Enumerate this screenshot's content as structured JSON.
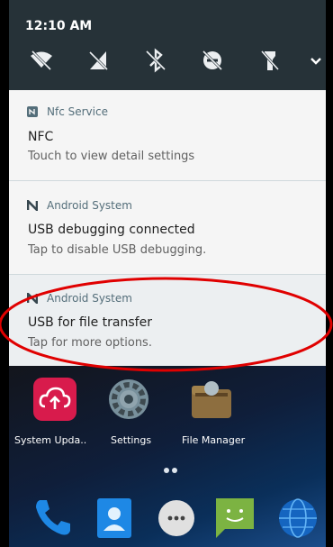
{
  "status_bar": {
    "time": "12:10 AM"
  },
  "quick_settings": {
    "icons": [
      "wifi-off-icon",
      "mobile-data-off-icon",
      "bluetooth-off-icon",
      "dnd-icon",
      "flashlight-off-icon"
    ],
    "expand_icon": "chevron-down-icon"
  },
  "notifications": [
    {
      "app": "Nfc Service",
      "title": "NFC",
      "text": "Touch to view detail settings"
    },
    {
      "app": "Android System",
      "title": "USB debugging connected",
      "text": "Tap to disable USB debugging."
    },
    {
      "app": "Android System",
      "title": "USB for file transfer",
      "text": "Tap for more options."
    }
  ],
  "home": {
    "apps": [
      {
        "label": "System Upda..",
        "icon": "cloud-upload-icon",
        "color": "#d81b4c"
      },
      {
        "label": "Settings",
        "icon": "gear-icon",
        "color": "#78909c"
      },
      {
        "label": "File Manager",
        "icon": "folder-icon",
        "color": "#8d6e3f"
      }
    ],
    "dock": [
      "phone-icon",
      "contacts-icon",
      "app-drawer-icon",
      "messages-icon",
      "browser-icon"
    ]
  },
  "annotation_color": "#e00000"
}
